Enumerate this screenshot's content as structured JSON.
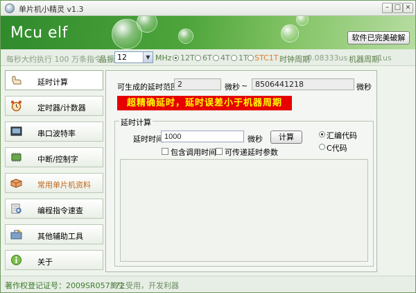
{
  "window": {
    "title": "单片机小精灵  v1.3"
  },
  "banner": {
    "logo": "Mcu elf",
    "crack_button": "软件已完美破解"
  },
  "infobar": {
    "tagline": "每秒大约执行 100 万条指令",
    "crystal_label": "晶振",
    "crystal_value": "12",
    "crystal_unit": "MHz",
    "cycle_options": [
      {
        "label": "12T",
        "checked": true
      },
      {
        "label": "6T",
        "checked": false
      },
      {
        "label": "4T",
        "checked": false
      },
      {
        "label": "1T",
        "checked": false
      },
      {
        "label": "STC1T",
        "checked": false
      }
    ],
    "clock_period_label": "时钟周期",
    "clock_period_value": "0.08333us",
    "machine_period_label": "机器周期",
    "machine_period_value": "1us"
  },
  "sidebar": {
    "items": [
      {
        "label": "延时计算",
        "icon": "hand-pointer-icon"
      },
      {
        "label": "定时器/计数器",
        "icon": "alarm-clock-icon"
      },
      {
        "label": "串口波特率",
        "icon": "serial-terminal-icon"
      },
      {
        "label": "中断/控制字",
        "icon": "chip-icon"
      },
      {
        "label": "常用单片机资料",
        "icon": "book-icon"
      },
      {
        "label": "编程指令速查",
        "icon": "document-search-icon"
      },
      {
        "label": "其他辅助工具",
        "icon": "toolbox-icon"
      },
      {
        "label": "关于",
        "icon": "info-icon"
      }
    ]
  },
  "main": {
    "range_label": "可生成的延时范围",
    "range_min": "2",
    "range_unit1": "微秒",
    "range_sep": "~",
    "range_max": "8506441218",
    "range_unit2": "微秒",
    "red_banner": "超精确延时，延时误差小于机器周期",
    "group_title": "延时计算",
    "delay_label": "延时时间",
    "delay_value": "1000",
    "delay_unit": "微秒",
    "calc_button": "计算",
    "include_call_label": "包含调用时间",
    "pass_param_label": "可传递延时参数",
    "asm_label": "汇编代码",
    "c_label": "C代码",
    "output_text": ""
  },
  "status": {
    "copyright": "著作权登记证号：2009SR057372",
    "slogan": "终生受用，开发利器"
  },
  "colors": {
    "banner_green": "#4ea53b",
    "red_banner_bg": "#e60000",
    "red_banner_text": "#ffff00",
    "stc_orange": "#e07a2c"
  }
}
